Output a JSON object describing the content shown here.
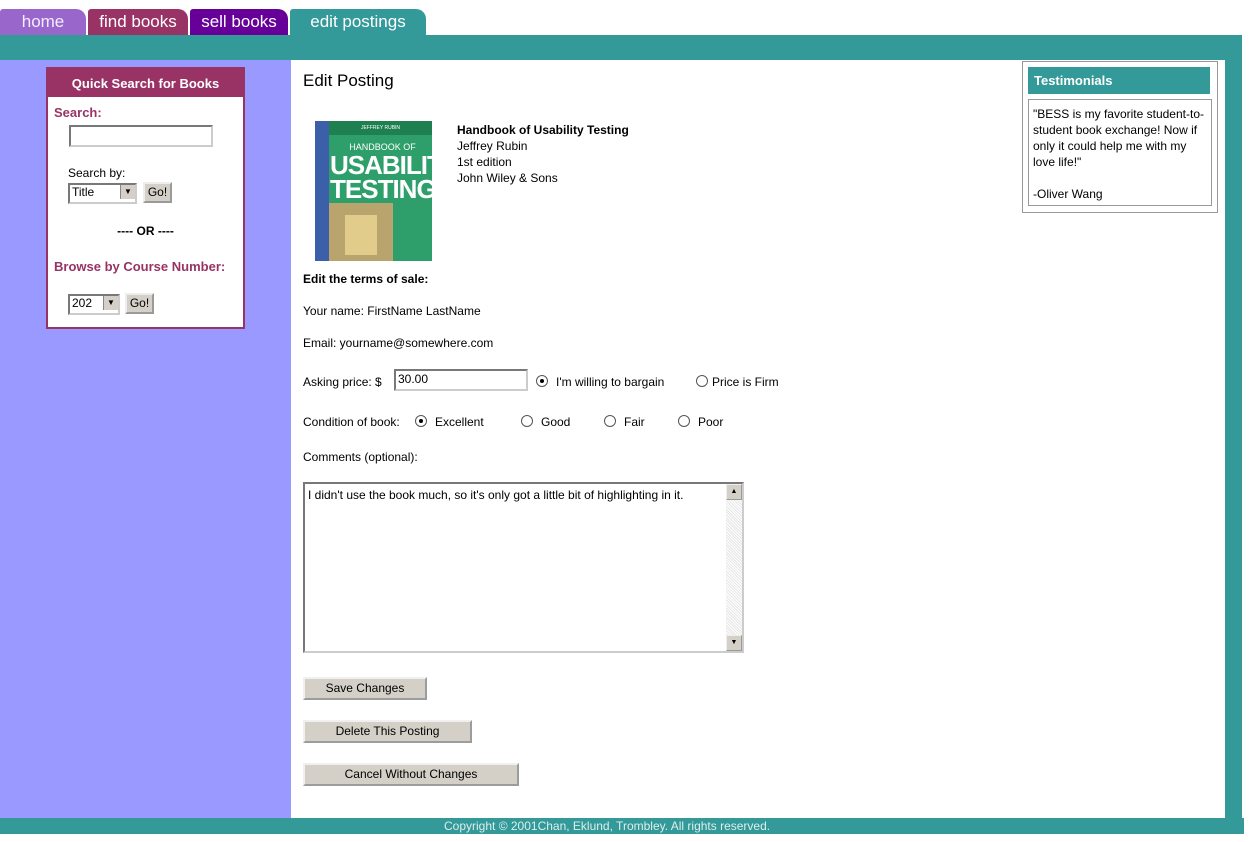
{
  "tabs": {
    "home": "home",
    "find": "find books",
    "sell": "sell books",
    "edit": "edit postings"
  },
  "sidebar": {
    "quick_search_title": "Quick Search for Books",
    "search_label": "Search:",
    "search_value": "",
    "search_by_label": "Search by:",
    "search_by_selected": "Title",
    "go_label": "Go!",
    "or_label": "---- OR ----",
    "browse_label": "Browse by Course Number:",
    "course_selected": "202"
  },
  "main": {
    "title": "Edit Posting",
    "book": {
      "title": "Handbook of Usability Testing",
      "author": "Jeffrey Rubin",
      "edition": "1st edition",
      "publisher": "John Wiley & Sons",
      "cover_author": "JEFFREY RUBIN",
      "cover_sub": "HANDBOOK OF",
      "cover_title_1": "USABILITY",
      "cover_title_2": "TESTING"
    },
    "terms_heading": "Edit the terms of sale:",
    "name_line": "Your name: FirstName LastName",
    "email_line": "Email: yourname@somewhere.com",
    "price_label": "Asking price: $",
    "price_value": "30.00",
    "bargain_label": "I'm willing to bargain",
    "firm_label": "Price is Firm",
    "price_mode_selected": "bargain",
    "condition_label": "Condition of book:",
    "condition_options": [
      "Excellent",
      "Good",
      "Fair",
      "Poor"
    ],
    "condition_selected": "Excellent",
    "comments_label": "Comments (optional):",
    "comments_value": "I didn't use the book much, so it's only got a little bit of highlighting in it.",
    "save_label": "Save Changes",
    "delete_label": "Delete This Posting",
    "cancel_label": "Cancel Without Changes"
  },
  "testimonials": {
    "title": "Testimonials",
    "quote": "\"BESS is my favorite student-to-student book exchange! Now if only it could help me with my love life!\"",
    "author": "-Oliver Wang"
  },
  "footer": {
    "copyright": "Copyright © 2001Chan, Eklund, Trombley. All rights reserved."
  },
  "colors": {
    "teal": "#339999",
    "plum": "#993366",
    "purple": "#660099",
    "lavender": "#9999ff"
  }
}
